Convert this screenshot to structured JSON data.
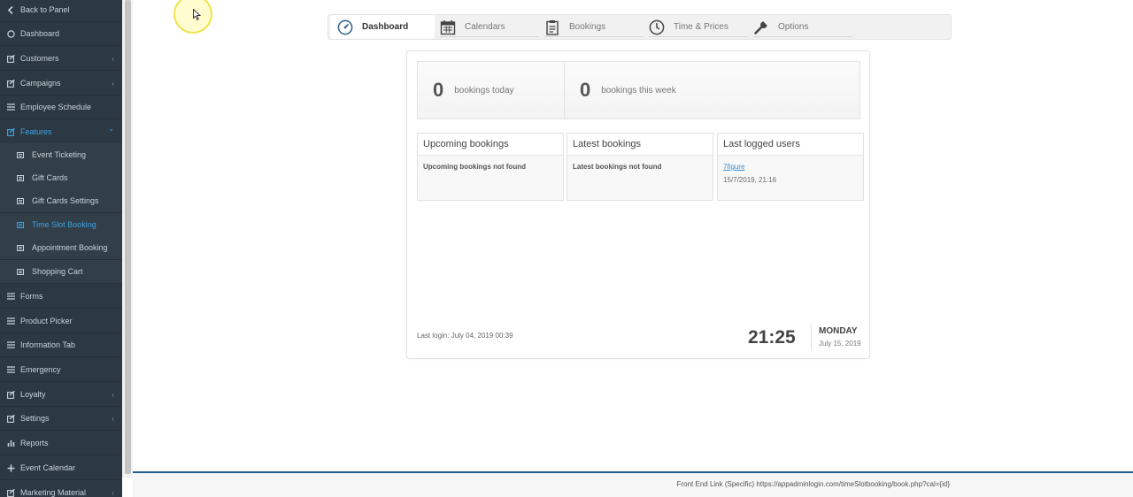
{
  "sidebar": {
    "items": [
      {
        "label": "Back to Panel",
        "icon": "chevron-left-icon"
      },
      {
        "label": "Dashboard",
        "icon": "dashboard-icon"
      },
      {
        "label": "Customers",
        "icon": "edit-icon",
        "chevron": "‹"
      },
      {
        "label": "Campaigns",
        "icon": "edit-icon",
        "chevron": "‹"
      },
      {
        "label": "Employee Schedule",
        "icon": "list-icon"
      },
      {
        "label": "Features",
        "icon": "edit-icon",
        "chevron": "⌄"
      },
      {
        "label": "Event Ticketing",
        "icon": "list-icon"
      },
      {
        "label": "Gift Cards",
        "icon": "list-icon"
      },
      {
        "label": "Gift Cards Settings",
        "icon": "list-icon"
      },
      {
        "label": "Time Slot Booking",
        "icon": "list-icon"
      },
      {
        "label": "Appointment Booking",
        "icon": "list-icon"
      },
      {
        "label": "Shopping Cart",
        "icon": "list-icon"
      },
      {
        "label": "Forms",
        "icon": "list-icon"
      },
      {
        "label": "Product Picker",
        "icon": "list-icon"
      },
      {
        "label": "Information Tab",
        "icon": "list-icon"
      },
      {
        "label": "Emergency",
        "icon": "list-icon"
      },
      {
        "label": "Loyalty",
        "icon": "edit-icon",
        "chevron": "‹"
      },
      {
        "label": "Settings",
        "icon": "edit-icon",
        "chevron": "‹"
      },
      {
        "label": "Reports",
        "icon": "bar-chart-icon"
      },
      {
        "label": "Event Calendar",
        "icon": "plus-icon"
      },
      {
        "label": "Marketing Material",
        "icon": "edit-icon",
        "chevron": "‹"
      }
    ]
  },
  "tabs": [
    {
      "label": "Dashboard",
      "icon": "speedometer-icon"
    },
    {
      "label": "Calendars",
      "icon": "calendar-icon"
    },
    {
      "label": "Bookings",
      "icon": "clipboard-icon"
    },
    {
      "label": "Time & Prices",
      "icon": "clock-icon"
    },
    {
      "label": "Options",
      "icon": "wrench-icon"
    }
  ],
  "stats": {
    "today_count": "0",
    "today_label": "bookings today",
    "week_count": "0",
    "week_label": "bookings this week"
  },
  "panels": {
    "upcoming_title": "Upcoming bookings",
    "upcoming_empty": "Upcoming bookings not found",
    "latest_title": "Latest bookings",
    "latest_empty": "Latest bookings not found",
    "users_title": "Last logged users",
    "user_name": "7figure",
    "user_time": "15/7/2019, 21:16"
  },
  "footer_info": {
    "last_login": "Last login: July 04, 2019 00:39",
    "clock": "21:25",
    "day": "MONDAY",
    "date": "July 15, 2019"
  },
  "footer": {
    "link_text": "Front End Link (Specific) https://appadminlogin.com/timeSlotbooking/book.php?cal={id}"
  },
  "colors": {
    "sidebar_bg": "#2c3842",
    "accent": "#3ba4e8",
    "footer_bar": "#1f5d8c"
  }
}
